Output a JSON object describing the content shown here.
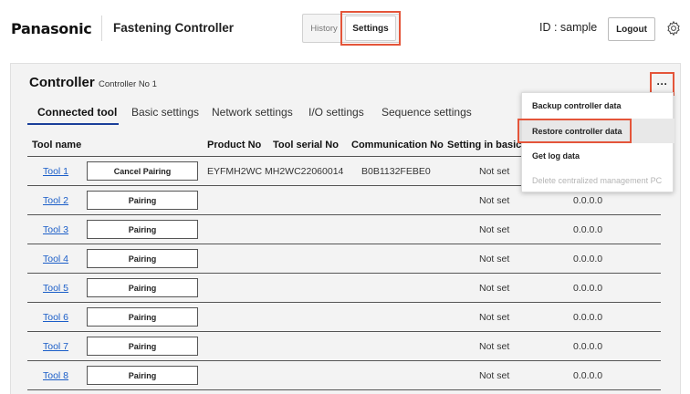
{
  "header": {
    "brand": "Panasonic",
    "app_title": "Fastening Controller",
    "nav": {
      "history": "History",
      "settings": "Settings"
    },
    "user_id": "ID : sample",
    "logout": "Logout"
  },
  "controller": {
    "title": "Controller",
    "subtitle": "Controller No 1",
    "more": "···"
  },
  "tabs": [
    "Connected tool",
    "Basic settings",
    "Network settings",
    "I/O settings",
    "Sequence settings"
  ],
  "table": {
    "headers": [
      "Tool name",
      "Product No",
      "Tool serial No",
      "Communication No",
      "Setting in basic m"
    ],
    "rows": [
      {
        "name": "Tool 1",
        "action": "Cancel Pairing",
        "product": "EYFMH2WC",
        "serial": "MH2WC22060014",
        "comm": "B0B1132FEBE0",
        "basic": "Not set",
        "ip": ""
      },
      {
        "name": "Tool 2",
        "action": "Pairing",
        "product": "",
        "serial": "",
        "comm": "",
        "basic": "Not set",
        "ip": "0.0.0.0"
      },
      {
        "name": "Tool 3",
        "action": "Pairing",
        "product": "",
        "serial": "",
        "comm": "",
        "basic": "Not set",
        "ip": "0.0.0.0"
      },
      {
        "name": "Tool 4",
        "action": "Pairing",
        "product": "",
        "serial": "",
        "comm": "",
        "basic": "Not set",
        "ip": "0.0.0.0"
      },
      {
        "name": "Tool 5",
        "action": "Pairing",
        "product": "",
        "serial": "",
        "comm": "",
        "basic": "Not set",
        "ip": "0.0.0.0"
      },
      {
        "name": "Tool 6",
        "action": "Pairing",
        "product": "",
        "serial": "",
        "comm": "",
        "basic": "Not set",
        "ip": "0.0.0.0"
      },
      {
        "name": "Tool 7",
        "action": "Pairing",
        "product": "",
        "serial": "",
        "comm": "",
        "basic": "Not set",
        "ip": "0.0.0.0"
      },
      {
        "name": "Tool 8",
        "action": "Pairing",
        "product": "",
        "serial": "",
        "comm": "",
        "basic": "Not set",
        "ip": "0.0.0.0"
      }
    ]
  },
  "menu": {
    "items": [
      "Backup controller data",
      "Restore controller data",
      "Get log data",
      "Delete centralized management PC"
    ]
  },
  "colors": {
    "highlight": "#e4553a",
    "link": "#1a5dc8",
    "tab_underline": "#1a3f9a"
  },
  "icons": {
    "settings": "gear-icon",
    "more": "ellipsis-icon"
  }
}
